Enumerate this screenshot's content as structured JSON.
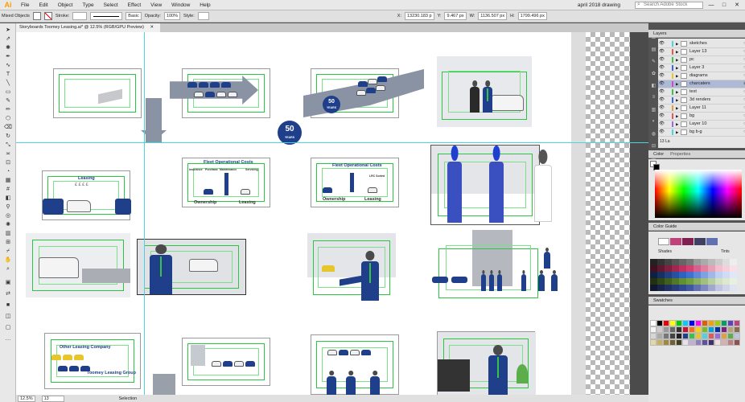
{
  "app": {
    "logo": "Ai"
  },
  "menu": [
    "File",
    "Edit",
    "Object",
    "Type",
    "Select",
    "Effect",
    "View",
    "Window",
    "Help"
  ],
  "workspace": "april 2018 drawing",
  "search_placeholder": "Search Adobe Stock",
  "window_controls": [
    "—",
    "□",
    "✕"
  ],
  "control_bar": {
    "selection": "Mixed Objects",
    "stroke_label": "Stroke:",
    "brush": "Basic",
    "opacity_label": "Opacity:",
    "opacity": "100%",
    "style_label": "Style:",
    "x_label": "X:",
    "x_value": "13230.183 p",
    "y_label": "Y:",
    "y_value": "9.467 px",
    "w_label": "W:",
    "w_value": "1136.507 px",
    "h_label": "H:",
    "h_value": "1799.496 px"
  },
  "document": {
    "tab": "Storyboards Toomey Leasing.ai* @ 12.5% (RGB/GPU Preview)",
    "close": "✕"
  },
  "status": {
    "zoom": "12.5%",
    "page": "13",
    "tool": "Selection"
  },
  "artboard_text": {
    "years_number": "50",
    "years_label": "YEARS",
    "banner_number": "50",
    "banner_label": "YEARS",
    "leasing": "Leasing",
    "pounds": "£ £ £ £",
    "fleet1": "Fleet Operational Costs",
    "fleet1_cols": [
      "Insurance",
      "Purchase",
      "Maintenance",
      "Servicing"
    ],
    "fleet1_left": "Ownership",
    "fleet1_right": "Leasing",
    "fleet2": "Fleet Operational Costs",
    "fleet2_side": "LRC Sorted",
    "fleet2_left": "Ownership",
    "fleet2_right": "Leasing",
    "other_company": "Other Leasing Company",
    "toomey_group": "Toomey Leasing Group"
  },
  "layers_panel": {
    "tabs": [
      "Layers"
    ],
    "rows": [
      {
        "name": "sketches",
        "color": "#4ad3e0",
        "selected": false
      },
      {
        "name": "Layer 13",
        "color": "#e05a5a",
        "selected": false
      },
      {
        "name": "pc",
        "color": "#39c24a",
        "selected": false
      },
      {
        "name": "Layer 3",
        "color": "#3a6be0",
        "selected": false
      },
      {
        "name": "diagrams",
        "color": "#e6c62a",
        "selected": false
      },
      {
        "name": "charcaters",
        "color": "#d04ad0",
        "selected": true
      },
      {
        "name": "text",
        "color": "#39c24a",
        "selected": false
      },
      {
        "name": "3d renders",
        "color": "#3a6be0",
        "selected": false
      },
      {
        "name": "Layer 11",
        "color": "#e0a040",
        "selected": false
      },
      {
        "name": "bg",
        "color": "#e05a5a",
        "selected": false
      },
      {
        "name": "Layer 10",
        "color": "#9a6be0",
        "selected": false
      },
      {
        "name": "bg b-g",
        "color": "#4ad3e0",
        "selected": false
      }
    ],
    "footer": "13 La"
  },
  "color_panel": {
    "tabs": [
      "Color",
      "Properties"
    ]
  },
  "color_guide": {
    "tab": "Color Guide",
    "shades": "Shades",
    "tints": "Tints"
  },
  "swatches": {
    "tab": "Swatches"
  }
}
